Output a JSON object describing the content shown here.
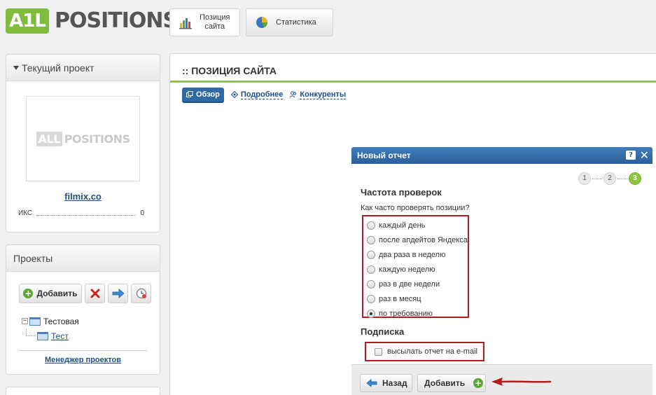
{
  "header": {
    "logo_a1": "A1L",
    "logo_positions": "POSITIONS",
    "tabs": [
      {
        "label": "Позиция\nсайта",
        "icon": "bar-chart-icon",
        "active": true
      },
      {
        "label": "Статистика",
        "icon": "pie-chart-icon",
        "active": false
      }
    ]
  },
  "sidebar": {
    "current_project": {
      "title": "Текущий проект",
      "thumb_logo_all": "ALL",
      "thumb_logo_positions": "POSITIONS",
      "site": "filmix.co",
      "iks_label": "ИКС",
      "iks_value": "0"
    },
    "projects": {
      "title": "Проекты",
      "add_label": "Добавить",
      "tree": [
        {
          "label": "Тестовая",
          "link": false
        },
        {
          "label": "Тест",
          "link": true
        }
      ],
      "manager_link": "Менеджер проектов"
    }
  },
  "main": {
    "title": ":: ПОЗИЦИЯ САЙТА",
    "subtabs": [
      {
        "label": "Обзор",
        "active": true
      },
      {
        "label": "Подробнее",
        "active": false
      },
      {
        "label": "Конкуренты",
        "active": false
      }
    ]
  },
  "dialog": {
    "title": "Новый отчет",
    "help": "?",
    "steps": [
      "1",
      "2",
      "3"
    ],
    "frequency": {
      "title": "Частота проверок",
      "question": "Как часто проверять позиции?",
      "options": [
        "каждый день",
        "после апдейтов Яндекса",
        "два раза в неделю",
        "каждую неделю",
        "раз в две недели",
        "раз в месяц",
        "по требованию"
      ],
      "selected": 6
    },
    "subscription": {
      "title": "Подписка",
      "email_label": "высылать отчет на e-mail",
      "checked": false
    },
    "buttons": {
      "back": "Назад",
      "add": "Добавить"
    }
  },
  "colors": {
    "accent_green": "#8dc63f",
    "dialog_blue": "#2c5f98",
    "highlight_red": "#b21d1d",
    "link_blue": "#1e4f8a"
  }
}
